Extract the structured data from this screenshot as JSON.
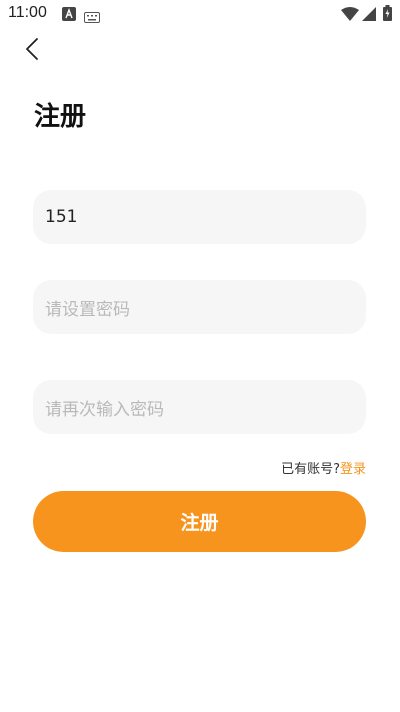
{
  "status_bar": {
    "time": "11:00",
    "icons": [
      "font-icon",
      "keyboard-icon",
      "wifi-icon",
      "signal-icon",
      "battery-icon"
    ]
  },
  "header": {
    "back_icon": "back-arrow-icon",
    "title": "注册"
  },
  "form": {
    "phone_value": "151",
    "password_placeholder": "请设置密码",
    "confirm_placeholder": "请再次输入密码"
  },
  "login_hint": {
    "text": "已有账号?",
    "link": "登录"
  },
  "submit_label": "注册",
  "colors": {
    "accent": "#f7941d",
    "field_bg": "#f6f6f6",
    "placeholder": "#b9b9b9"
  }
}
